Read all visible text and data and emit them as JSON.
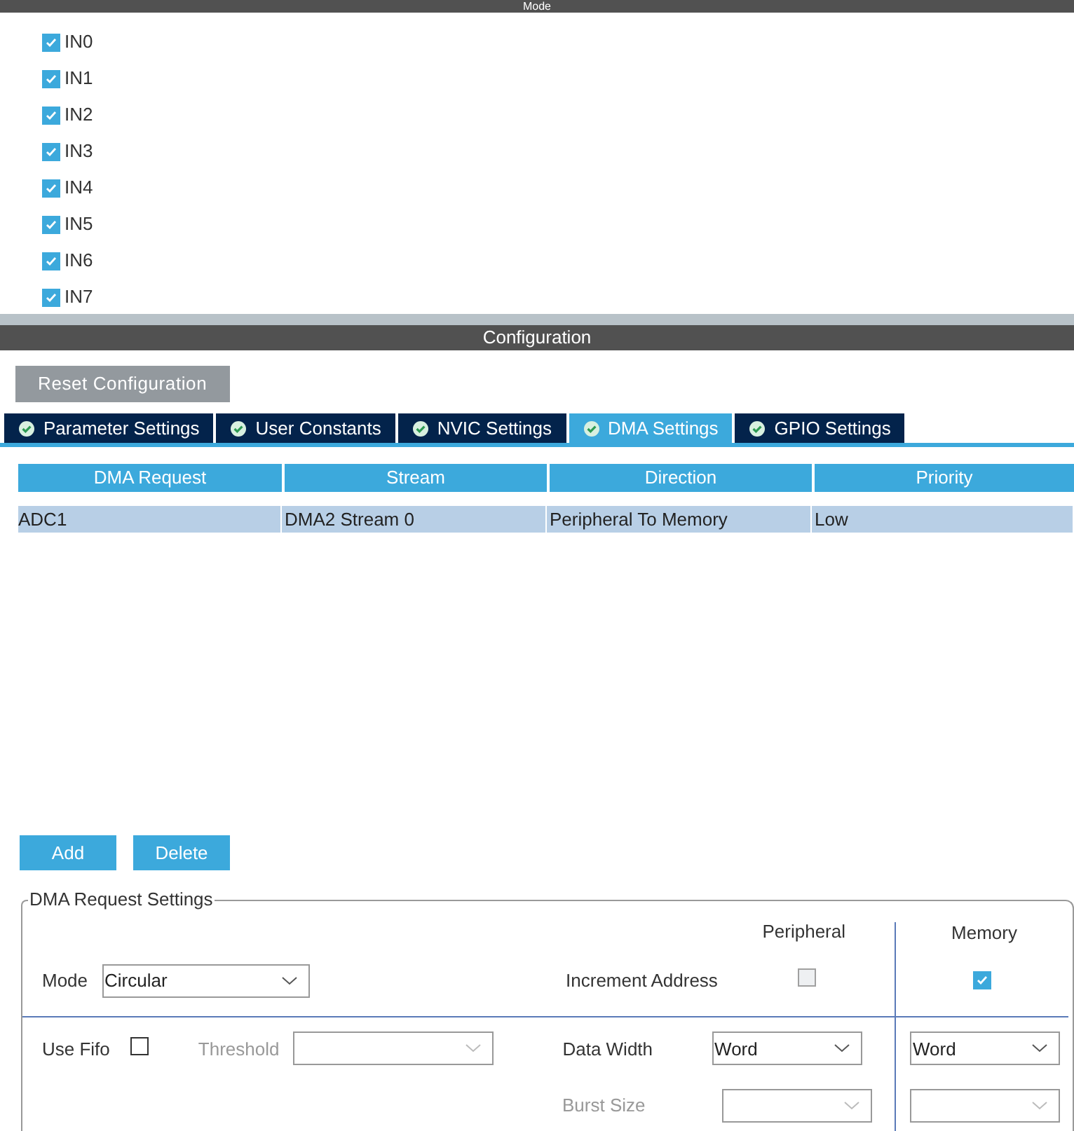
{
  "mode_panel": {
    "title": "Mode",
    "channels": [
      {
        "label": "IN0",
        "checked": true
      },
      {
        "label": "IN1",
        "checked": true
      },
      {
        "label": "IN2",
        "checked": true
      },
      {
        "label": "IN3",
        "checked": true
      },
      {
        "label": "IN4",
        "checked": true
      },
      {
        "label": "IN5",
        "checked": true
      },
      {
        "label": "IN6",
        "checked": true
      },
      {
        "label": "IN7",
        "checked": true
      }
    ]
  },
  "configuration": {
    "title": "Configuration",
    "reset_button": "Reset Configuration",
    "tabs": [
      {
        "label": "Parameter Settings",
        "selected": false
      },
      {
        "label": "User Constants",
        "selected": false
      },
      {
        "label": "NVIC Settings",
        "selected": false
      },
      {
        "label": "DMA Settings",
        "selected": true
      },
      {
        "label": "GPIO Settings",
        "selected": false
      }
    ],
    "table": {
      "columns": [
        "DMA Request",
        "Stream",
        "Direction",
        "Priority"
      ],
      "rows": [
        {
          "cells": [
            "ADC1",
            "DMA2 Stream 0",
            "Peripheral To Memory",
            "Low"
          ],
          "selected": true
        }
      ]
    },
    "buttons": [
      "Add",
      "Delete"
    ],
    "request_settings": {
      "title": "DMA Request Settings",
      "mode": {
        "label": "Mode",
        "value": "Circular"
      },
      "use_fifo": {
        "label": "Use Fifo",
        "checked": false
      },
      "threshold": {
        "label": "Threshold",
        "disabled": true
      },
      "peripheral_header": "Peripheral",
      "memory_header": "Memory",
      "increment_address": {
        "label": "Increment Address",
        "peripheral": {
          "checked": false,
          "disabled": true
        },
        "memory": {
          "checked": true
        }
      },
      "data_width": {
        "label": "Data Width",
        "disabled": false,
        "peripheral": "Word",
        "memory": "Word"
      },
      "burst_size": {
        "label": "Burst Size",
        "disabled": true
      }
    }
  }
}
